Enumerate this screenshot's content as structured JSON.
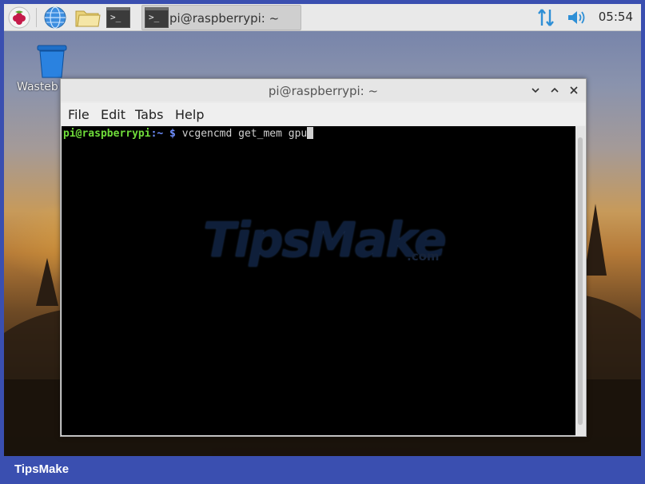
{
  "taskbar": {
    "task_label": "pi@raspberrypi: ~",
    "clock": "05:54",
    "icons": [
      "raspberry-menu-icon",
      "web-browser-icon",
      "file-manager-icon",
      "terminal-icon"
    ]
  },
  "desktop": {
    "trash_label": "Wasteb"
  },
  "window": {
    "title": "pi@raspberrypi: ~",
    "menus": [
      "File",
      "Edit",
      "Tabs",
      "Help"
    ]
  },
  "terminal": {
    "user_host": "pi@raspberrypi",
    "path": ":~",
    "dollar": " $",
    "command": " vcgencmd get_mem gpu"
  },
  "watermark": {
    "main": "TipsMake",
    "suffix": ".com"
  },
  "brand": "TipsMake"
}
